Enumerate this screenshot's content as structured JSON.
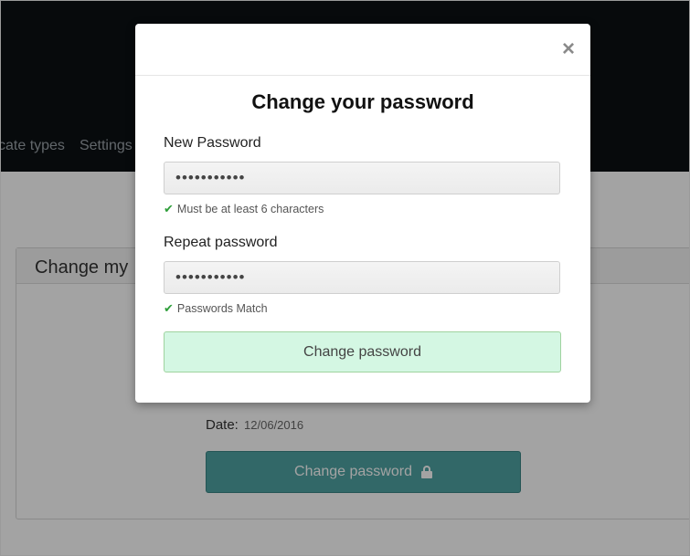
{
  "nav": {
    "items": [
      "cate types",
      "Settings"
    ]
  },
  "panel": {
    "title": "Change my",
    "date_label": "Date:",
    "date_value": "12/06/2016",
    "button_label": "Change password"
  },
  "modal": {
    "close_label": "×",
    "title": "Change your password",
    "new_password": {
      "label": "New Password",
      "value": "•••••••••••",
      "hint": "Must be at least 6 characters"
    },
    "repeat_password": {
      "label": "Repeat password",
      "value": "•••••••••••",
      "hint": "Passwords Match"
    },
    "submit_label": "Change password"
  },
  "colors": {
    "accent_green": "#2e9e3a",
    "submit_bg": "#d4f7e3",
    "panel_button_bg": "#4fa3a3",
    "topbar_bg": "#0c1014"
  },
  "icons": {
    "check": "check-icon",
    "lock": "lock-icon",
    "close": "close-icon"
  }
}
